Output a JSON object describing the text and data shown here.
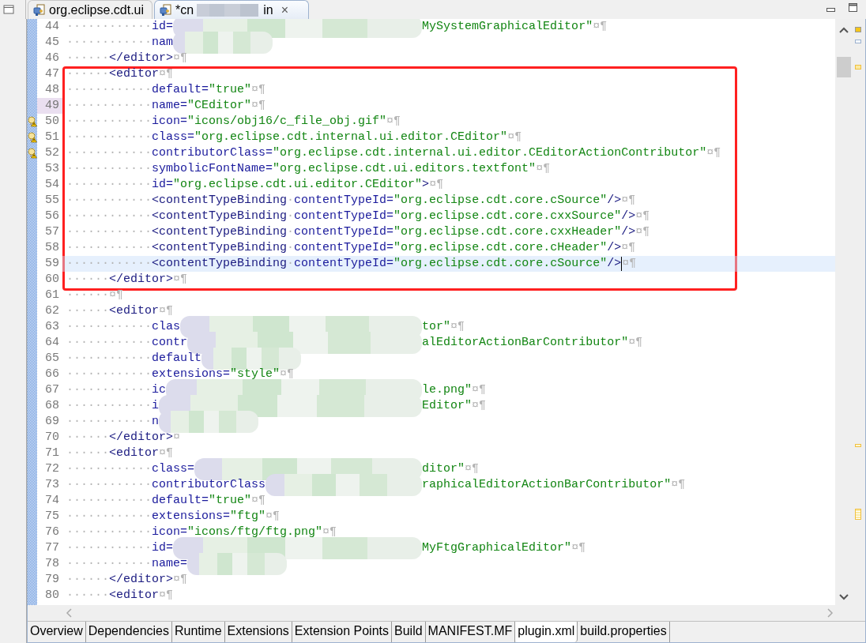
{
  "editor_tabs": [
    {
      "label": "org.eclipse.cdt.ui",
      "selected": false
    },
    {
      "label": "*cn",
      "label_tail": "in",
      "close": "×",
      "selected": true
    }
  ],
  "lines": [
    {
      "num": "44",
      "indent": "············",
      "code": [
        {
          "kind": "attr",
          "text": "id="
        },
        {
          "kind": "redacted"
        },
        {
          "kind": "value",
          "text": "MySystemGraphicalEditor\""
        }
      ],
      "eol": "¤¶"
    },
    {
      "num": "45",
      "indent": "············",
      "code": [
        {
          "kind": "attr",
          "text": "nam"
        },
        {
          "kind": "redacted"
        }
      ]
    },
    {
      "num": "46",
      "indent": "······",
      "code": [
        {
          "kind": "tag",
          "text": "</editor>"
        }
      ],
      "eol": "¤¶"
    },
    {
      "num": "47",
      "indent": "······",
      "code": [
        {
          "kind": "tag",
          "text": "<editor"
        }
      ],
      "eol": "¤¶",
      "framed": true
    },
    {
      "num": "48",
      "indent": "············",
      "code": [
        {
          "kind": "attr",
          "text": "default="
        },
        {
          "kind": "value",
          "text": "\"true\""
        }
      ],
      "eol": "¤¶"
    },
    {
      "num": "49",
      "indent": "············",
      "code": [
        {
          "kind": "attr",
          "text": "name="
        },
        {
          "kind": "value",
          "text": "\"CEditor\""
        }
      ],
      "eol": "¤¶",
      "marked": true
    },
    {
      "num": "50",
      "indent": "············",
      "code": [
        {
          "kind": "attr",
          "text": "icon="
        },
        {
          "kind": "value",
          "text": "\"icons/obj16/c_file_obj.gif\""
        }
      ],
      "eol": "¤¶",
      "warning": true
    },
    {
      "num": "51",
      "indent": "············",
      "code": [
        {
          "kind": "attr",
          "text": "class="
        },
        {
          "kind": "value",
          "text": "\"org.eclipse.cdt.internal.ui.editor.CEditor\""
        }
      ],
      "eol": "¤¶",
      "warning": true
    },
    {
      "num": "52",
      "indent": "············",
      "code": [
        {
          "kind": "attr",
          "text": "contributorClass="
        },
        {
          "kind": "value",
          "text": "\"org.eclipse.cdt.internal.ui.editor.CEditorActionContributor\""
        }
      ],
      "eol": "¤¶",
      "warning": true
    },
    {
      "num": "53",
      "indent": "············",
      "code": [
        {
          "kind": "attr",
          "text": "symbolicFontName="
        },
        {
          "kind": "value",
          "text": "\"org.eclipse.cdt.ui.editors.textfont\""
        }
      ],
      "eol": "¤¶"
    },
    {
      "num": "54",
      "indent": "············",
      "code": [
        {
          "kind": "attr",
          "text": "id="
        },
        {
          "kind": "value",
          "text": "\"org.eclipse.cdt.ui.editor.CEditor\""
        },
        {
          "kind": "tag",
          "text": ">"
        }
      ],
      "eol": "¤¶"
    },
    {
      "num": "55",
      "indent": "············",
      "code": [
        {
          "kind": "tag",
          "text": "<contentTypeBinding"
        },
        {
          "kind": "ws",
          "text": "·"
        },
        {
          "kind": "attr",
          "text": "contentTypeId="
        },
        {
          "kind": "value",
          "text": "\"org.eclipse.cdt.core.cSource\""
        },
        {
          "kind": "tag",
          "text": "/>"
        }
      ],
      "eol": "¤¶"
    },
    {
      "num": "56",
      "indent": "············",
      "code": [
        {
          "kind": "tag",
          "text": "<contentTypeBinding"
        },
        {
          "kind": "ws",
          "text": "·"
        },
        {
          "kind": "attr",
          "text": "contentTypeId="
        },
        {
          "kind": "value",
          "text": "\"org.eclipse.cdt.core.cxxSource\""
        },
        {
          "kind": "tag",
          "text": "/>"
        }
      ],
      "eol": "¤¶"
    },
    {
      "num": "57",
      "indent": "············",
      "code": [
        {
          "kind": "tag",
          "text": "<contentTypeBinding"
        },
        {
          "kind": "ws",
          "text": "·"
        },
        {
          "kind": "attr",
          "text": "contentTypeId="
        },
        {
          "kind": "value",
          "text": "\"org.eclipse.cdt.core.cxxHeader\""
        },
        {
          "kind": "tag",
          "text": "/>"
        }
      ],
      "eol": "¤¶"
    },
    {
      "num": "58",
      "indent": "············",
      "code": [
        {
          "kind": "tag",
          "text": "<contentTypeBinding"
        },
        {
          "kind": "ws",
          "text": "·"
        },
        {
          "kind": "attr",
          "text": "contentTypeId="
        },
        {
          "kind": "value",
          "text": "\"org.eclipse.cdt.core.cHeader\""
        },
        {
          "kind": "tag",
          "text": "/>"
        }
      ],
      "eol": "¤¶"
    },
    {
      "num": "59",
      "indent": "············",
      "code": [
        {
          "kind": "tag",
          "text": "<contentTypeBinding"
        },
        {
          "kind": "ws",
          "text": "·"
        },
        {
          "kind": "attr",
          "text": "contentTypeId="
        },
        {
          "kind": "value",
          "text": "\"org.eclipse.cdt.core.cSource\""
        },
        {
          "kind": "tag",
          "text": "/>"
        }
      ],
      "eol": "¤¶",
      "current": true
    },
    {
      "num": "60",
      "indent": "······",
      "code": [
        {
          "kind": "tag",
          "text": "</editor>"
        }
      ],
      "eol": "¤¶",
      "framed": true
    },
    {
      "num": "61",
      "indent": "······",
      "eol": "¤¶"
    },
    {
      "num": "62",
      "indent": "······",
      "code": [
        {
          "kind": "tag",
          "text": "<editor"
        }
      ],
      "eol": "¤¶"
    },
    {
      "num": "63",
      "indent": "············",
      "code": [
        {
          "kind": "attr",
          "text": "clas"
        },
        {
          "kind": "redacted"
        },
        {
          "kind": "value",
          "text": "tor\""
        }
      ],
      "eol": "¤¶"
    },
    {
      "num": "64",
      "indent": "············",
      "code": [
        {
          "kind": "attr",
          "text": "contr"
        },
        {
          "kind": "redacted"
        },
        {
          "kind": "value",
          "text": "alEditorActionBarContributor\""
        }
      ],
      "eol": "¤¶"
    },
    {
      "num": "65",
      "indent": "············",
      "code": [
        {
          "kind": "attr",
          "text": "default"
        },
        {
          "kind": "redacted"
        }
      ]
    },
    {
      "num": "66",
      "indent": "············",
      "code": [
        {
          "kind": "attr",
          "text": "extensions="
        },
        {
          "kind": "value",
          "text": "\"style\""
        }
      ],
      "eol": "¤¶"
    },
    {
      "num": "67",
      "indent": "············",
      "code": [
        {
          "kind": "attr",
          "text": "ic"
        },
        {
          "kind": "redacted"
        },
        {
          "kind": "value",
          "text": "le.png\""
        }
      ],
      "eol": "¤¶"
    },
    {
      "num": "68",
      "indent": "············",
      "code": [
        {
          "kind": "attr",
          "text": "i"
        },
        {
          "kind": "redacted"
        },
        {
          "kind": "value",
          "text": "Editor\""
        }
      ],
      "eol": "¤¶"
    },
    {
      "num": "69",
      "indent": "············",
      "code": [
        {
          "kind": "attr",
          "text": "n"
        },
        {
          "kind": "redacted"
        }
      ]
    },
    {
      "num": "70",
      "indent": "······",
      "code": [
        {
          "kind": "tag",
          "text": "</editor>"
        }
      ],
      "eol": "¤"
    },
    {
      "num": "71",
      "indent": "······",
      "code": [
        {
          "kind": "tag",
          "text": "<editor"
        }
      ],
      "eol": "¤¶"
    },
    {
      "num": "72",
      "indent": "············",
      "code": [
        {
          "kind": "attr",
          "text": "class="
        },
        {
          "kind": "redacted"
        },
        {
          "kind": "value",
          "text": "ditor\""
        }
      ],
      "eol": "¤¶"
    },
    {
      "num": "73",
      "indent": "············",
      "code": [
        {
          "kind": "attr",
          "text": "contributorClass"
        },
        {
          "kind": "redacted"
        },
        {
          "kind": "value",
          "text": "raphicalEditorActionBarContributor\""
        }
      ],
      "eol": "¤¶"
    },
    {
      "num": "74",
      "indent": "············",
      "code": [
        {
          "kind": "attr",
          "text": "default="
        },
        {
          "kind": "value",
          "text": "\"true\""
        }
      ],
      "eol": "¤¶"
    },
    {
      "num": "75",
      "indent": "············",
      "code": [
        {
          "kind": "attr",
          "text": "extensions="
        },
        {
          "kind": "value",
          "text": "\"ftg\""
        }
      ],
      "eol": "¤¶"
    },
    {
      "num": "76",
      "indent": "············",
      "code": [
        {
          "kind": "attr",
          "text": "icon="
        },
        {
          "kind": "value",
          "text": "\"icons/ftg/ftg.png\""
        }
      ],
      "eol": "¤¶"
    },
    {
      "num": "77",
      "indent": "············",
      "code": [
        {
          "kind": "attr",
          "text": "id="
        },
        {
          "kind": "redacted"
        },
        {
          "kind": "value",
          "text": "MyFtgGraphicalEditor\""
        }
      ],
      "eol": "¤¶"
    },
    {
      "num": "78",
      "indent": "············",
      "code": [
        {
          "kind": "attr",
          "text": "name="
        },
        {
          "kind": "redacted"
        }
      ]
    },
    {
      "num": "79",
      "indent": "······",
      "code": [
        {
          "kind": "tag",
          "text": "</editor>"
        }
      ],
      "eol": "¤¶"
    },
    {
      "num": "80",
      "indent": "······",
      "code": [
        {
          "kind": "tag",
          "text": "<editor"
        }
      ],
      "eol": "¤¶"
    }
  ],
  "highlight_frame": {
    "color": "#ff2020"
  },
  "page_tabs": [
    {
      "label": "Overview",
      "selected": false
    },
    {
      "label": "Dependencies",
      "selected": false
    },
    {
      "label": "Runtime",
      "selected": false
    },
    {
      "label": "Extensions",
      "selected": false
    },
    {
      "label": "Extension Points",
      "selected": false
    },
    {
      "label": "Build",
      "selected": false
    },
    {
      "label": "MANIFEST.MF",
      "selected": false
    },
    {
      "label": "plugin.xml",
      "selected": true
    },
    {
      "label": "build.properties",
      "selected": false
    }
  ]
}
